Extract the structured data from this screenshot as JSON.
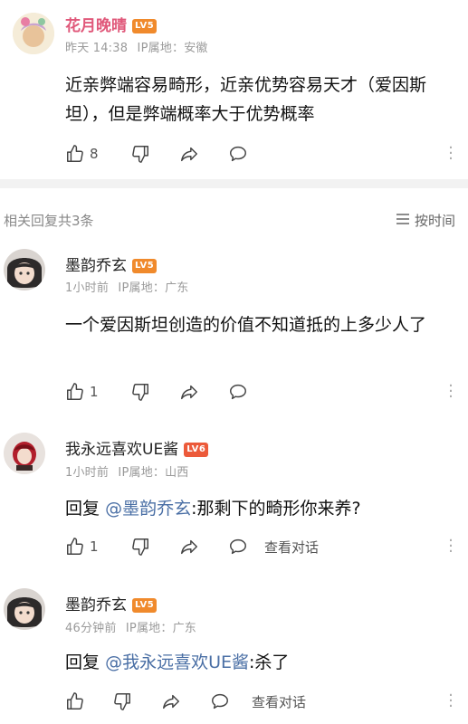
{
  "main_comment": {
    "username": "花月晚晴",
    "level": "LV5",
    "time": "昨天 14:38",
    "ip_label": "IP属地：",
    "ip_location": "安徽",
    "content": "近亲弊端容易畸形，近亲优势容易天才（爱因斯坦），但是弊端概率大于优势概率",
    "like_count": "8"
  },
  "replies_header": {
    "title": "相关回复共3条",
    "sort_label": "按时间"
  },
  "replies": [
    {
      "username": "墨韵乔玄",
      "level": "LV5",
      "time": "1小时前",
      "ip_label": "IP属地：",
      "ip_location": "广东",
      "content": "一个爱因斯坦创造的价值不知道抵的上多少人了",
      "like_count": "1"
    },
    {
      "username": "我永远喜欢UE酱",
      "level": "LV6",
      "time": "1小时前",
      "ip_label": "IP属地：",
      "ip_location": "山西",
      "reply_prefix": "回复",
      "mention": "@墨韵乔玄",
      "content": ":那剩下的畸形你来养?",
      "like_count": "1",
      "view_dialog": "查看对话"
    },
    {
      "username": "墨韵乔玄",
      "level": "LV5",
      "time": "46分钟前",
      "ip_label": "IP属地：",
      "ip_location": "广东",
      "reply_prefix": "回复",
      "mention": "@我永远喜欢UE酱",
      "content": ":杀了",
      "like_count": "",
      "view_dialog": "查看对话"
    }
  ],
  "icons": [
    "like-icon",
    "dislike-icon",
    "share-icon",
    "comment-icon",
    "more-icon",
    "sort-icon"
  ],
  "colors": {
    "level_orange": "#f08a2c",
    "level_red": "#ec5a3a",
    "mention_blue": "#4a6fa5",
    "username_pink": "#e0587a"
  }
}
